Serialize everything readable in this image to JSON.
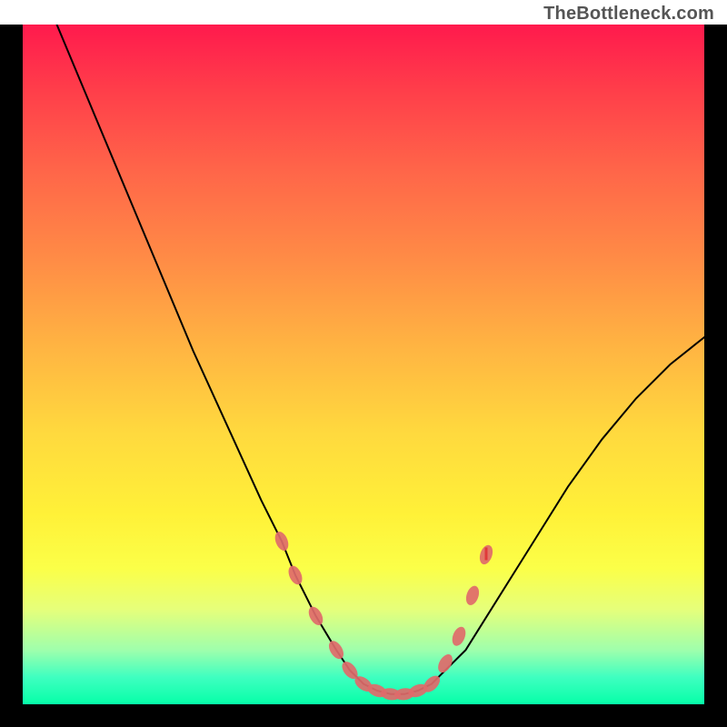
{
  "watermark": "TheBottleneck.com",
  "chart_data": {
    "type": "line",
    "title": "",
    "xlabel": "",
    "ylabel": "",
    "xlim": [
      0,
      100
    ],
    "ylim": [
      0,
      100
    ],
    "series": [
      {
        "name": "curve",
        "x": [
          5,
          10,
          15,
          20,
          25,
          30,
          35,
          38,
          40,
          43,
          46,
          48,
          50,
          52,
          54,
          56,
          58,
          60,
          62,
          65,
          70,
          75,
          80,
          85,
          90,
          95,
          100
        ],
        "y": [
          100,
          88,
          76,
          64,
          52,
          41,
          30,
          24,
          19,
          13,
          8,
          5,
          3,
          2,
          1.5,
          1.5,
          2,
          3,
          5,
          8,
          16,
          24,
          32,
          39,
          45,
          50,
          54
        ]
      }
    ],
    "markers": {
      "name": "highlight-dots",
      "color": "#e06a6a",
      "x": [
        38,
        40,
        43,
        46,
        48,
        50,
        52,
        54,
        56,
        58,
        60,
        62,
        64,
        66,
        68
      ],
      "y": [
        24,
        19,
        13,
        8,
        5,
        3,
        2,
        1.5,
        1.5,
        2,
        3,
        6,
        10,
        16,
        22
      ]
    },
    "tick_marker": {
      "x": 68,
      "y": 22,
      "color": "#e03a3a"
    },
    "gradient_stops": [
      {
        "pos": 0,
        "color": "#ff1a4d"
      },
      {
        "pos": 22,
        "color": "#ff6749"
      },
      {
        "pos": 48,
        "color": "#ffb642"
      },
      {
        "pos": 72,
        "color": "#fff138"
      },
      {
        "pos": 92,
        "color": "#9fffac"
      },
      {
        "pos": 100,
        "color": "#06ffa8"
      }
    ]
  }
}
